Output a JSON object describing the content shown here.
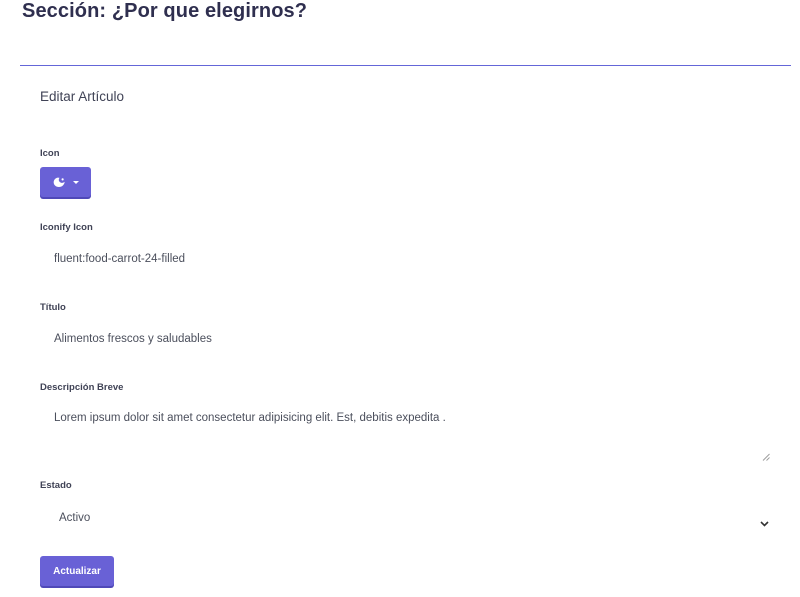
{
  "page": {
    "title": "Sección: ¿Por que elegirnos?"
  },
  "form": {
    "card_title": "Editar Artículo",
    "icon": {
      "label": "Icon",
      "selected_icon": "moon-icon"
    },
    "iconify": {
      "label": "Iconify Icon",
      "value": "fluent:food-carrot-24-filled"
    },
    "titulo": {
      "label": "Título",
      "value": "Alimentos frescos y saludables"
    },
    "descripcion": {
      "label": "Descripción Breve",
      "value": "Lorem ipsum dolor sit amet consectetur adipisicing elit. Est, debitis expedita ."
    },
    "estado": {
      "label": "Estado",
      "selected": "Activo"
    },
    "submit_label": "Actualizar"
  },
  "colors": {
    "accent": "#6961d6",
    "rule": "#6466d8",
    "heading": "#2f2f4f"
  }
}
